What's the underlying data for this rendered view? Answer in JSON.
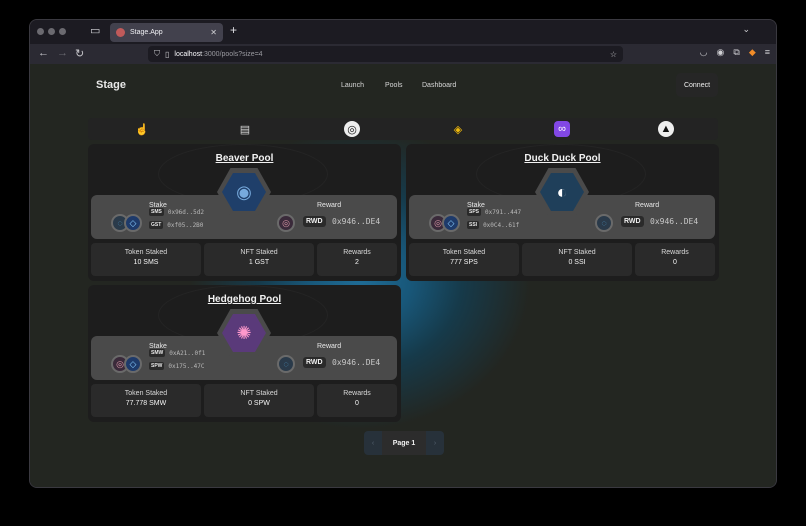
{
  "browser": {
    "tab_title": "Stage.App",
    "tab_close": "✕",
    "new_tab": "+",
    "url_host": "localhost",
    "url_rest": ":3000/pools?size=4"
  },
  "app": {
    "brand": "Stage",
    "nav": [
      "Launch",
      "Pools",
      "Dashboard"
    ],
    "connect_label": "Connect"
  },
  "chains": [
    "hand-icon",
    "scroll-icon",
    "swirl-icon",
    "cube-icon",
    "link-icon",
    "triangle-icon"
  ],
  "labels": {
    "stake": "Stake",
    "reward": "Reward",
    "token_staked": "Token Staked",
    "nft_staked": "NFT Staked",
    "rewards": "Rewards"
  },
  "pools": [
    {
      "name": "Beaver Pool",
      "tokens": [
        {
          "sym": "SMS",
          "addr": "0x96d..5d2"
        },
        {
          "sym": "GST",
          "addr": "0xf05..2B0"
        }
      ],
      "reward_sym": "RWD",
      "reward_addr": "0x946..DE4",
      "token_staked": "10 SMS",
      "nft_staked": "1 GST",
      "rewards": "2"
    },
    {
      "name": "Duck Duck Pool",
      "tokens": [
        {
          "sym": "SPS",
          "addr": "0x791..447"
        },
        {
          "sym": "SSI",
          "addr": "0x0C4..61f"
        }
      ],
      "reward_sym": "RWD",
      "reward_addr": "0x946..DE4",
      "token_staked": "777 SPS",
      "nft_staked": "0 SSI",
      "rewards": "0"
    },
    {
      "name": "Hedgehog Pool",
      "tokens": [
        {
          "sym": "SMW",
          "addr": "0xA21..0f1"
        },
        {
          "sym": "SPW",
          "addr": "0x175..47C"
        }
      ],
      "reward_sym": "RWD",
      "reward_addr": "0x946..DE4",
      "token_staked": "77.778 SMW",
      "nft_staked": "0 SPW",
      "rewards": "0"
    }
  ],
  "pager": {
    "prev": "‹",
    "label": "Page 1",
    "next": "›"
  }
}
